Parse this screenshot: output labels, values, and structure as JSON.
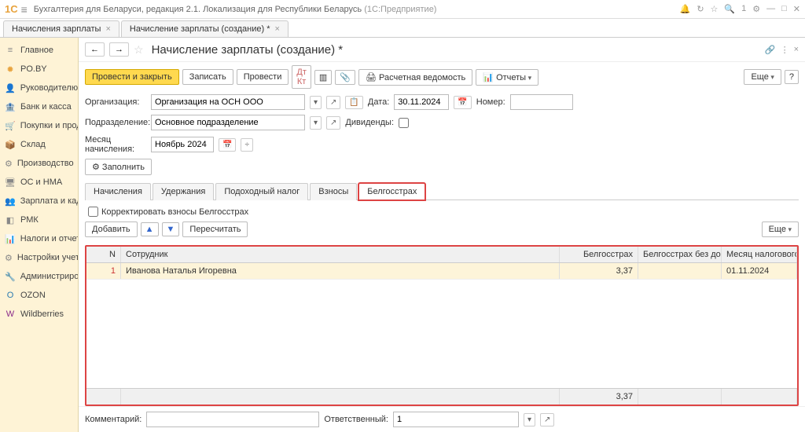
{
  "titlebar": {
    "logo": "1С",
    "title": "Бухгалтерия для Беларуси, редакция 2.1. Локализация для Республики Беларусь",
    "subtitle": "(1С:Предприятие)"
  },
  "tabs": [
    {
      "label": "Начисления зарплаты"
    },
    {
      "label": "Начисление зарплаты (создание) *"
    }
  ],
  "sidebar": {
    "items": [
      {
        "icon": "≡",
        "label": "Главное",
        "color": "#888"
      },
      {
        "icon": "✹",
        "label": "PO.BY",
        "color": "#e8a33d"
      },
      {
        "icon": "👤",
        "label": "Руководителю",
        "color": "#888"
      },
      {
        "icon": "🏦",
        "label": "Банк и касса",
        "color": "#888"
      },
      {
        "icon": "🛒",
        "label": "Покупки и продажи",
        "color": "#888"
      },
      {
        "icon": "📦",
        "label": "Склад",
        "color": "#888"
      },
      {
        "icon": "⚙",
        "label": "Производство",
        "color": "#888"
      },
      {
        "icon": "🖥",
        "label": "ОС и НМА",
        "color": "#888"
      },
      {
        "icon": "👥",
        "label": "Зарплата и кадры",
        "color": "#888"
      },
      {
        "icon": "◧",
        "label": "РМК",
        "color": "#888"
      },
      {
        "icon": "📊",
        "label": "Налоги и отчетность",
        "color": "#888"
      },
      {
        "icon": "⚙",
        "label": "Настройки учета",
        "color": "#888"
      },
      {
        "icon": "🔧",
        "label": "Администрирование",
        "color": "#888"
      },
      {
        "icon": "O",
        "label": "OZON",
        "color": "#2a7ab0"
      },
      {
        "icon": "W",
        "label": "Wildberries",
        "color": "#8a2b8a"
      }
    ]
  },
  "page": {
    "title": "Начисление зарплаты (создание) *"
  },
  "toolbar": {
    "post_close": "Провести и закрыть",
    "save": "Записать",
    "post": "Провести",
    "payroll_sheet": "Расчетная ведомость",
    "reports": "Отчеты",
    "more": "Еще"
  },
  "form": {
    "org_label": "Организация:",
    "org_value": "Организация на ОСН ООО",
    "date_label": "Дата:",
    "date_value": "30.11.2024",
    "number_label": "Номер:",
    "number_value": "",
    "dept_label": "Подразделение:",
    "dept_value": "Основное подразделение",
    "dividends_label": "Дивиденды:",
    "month_label": "Месяц начисления:",
    "month_value": "Ноябрь 2024",
    "fill": "Заполнить"
  },
  "subtabs": [
    {
      "label": "Начисления"
    },
    {
      "label": "Удержания"
    },
    {
      "label": "Подоходный налог"
    },
    {
      "label": "Взносы"
    },
    {
      "label": "Белгосстрах"
    }
  ],
  "panel": {
    "correct_label": "Корректировать взносы Белгосстрах",
    "add": "Добавить",
    "recalc": "Пересчитать",
    "more": "Еще"
  },
  "table": {
    "headers": {
      "n": "N",
      "employee": "Сотрудник",
      "b1": "Белгосстрах",
      "b2": "Белгосстрах без доплаты",
      "month": "Месяц налогового периода"
    },
    "rows": [
      {
        "n": "1",
        "employee": "Иванова Наталья Игоревна",
        "b1": "3,37",
        "b2": "",
        "month": "01.11.2024"
      }
    ],
    "footer": {
      "b1": "3,37"
    }
  },
  "bottom": {
    "comment_label": "Комментарий:",
    "comment_value": "",
    "responsible_label": "Ответственный:",
    "responsible_value": "1"
  }
}
